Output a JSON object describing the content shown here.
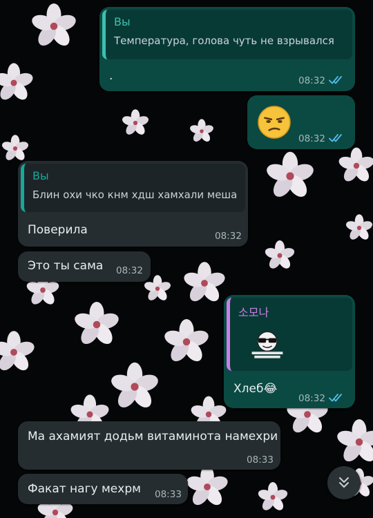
{
  "colors": {
    "outgoing_bubble": "#0b4a43",
    "incoming_bubble": "#262d31",
    "quote_name_self": "#3fbfb0",
    "quote_name_contact": "#c980e6",
    "read_ticks": "#53bdeb"
  },
  "messages": [
    {
      "id": "m1",
      "direction": "outgoing",
      "quote": {
        "author": "Вы",
        "text": "Температура, голова чуть не взрывался"
      },
      "text": ".",
      "time": "08:32",
      "status": "read"
    },
    {
      "id": "m2",
      "direction": "outgoing",
      "emoji": "unamused-face",
      "time": "08:32",
      "status": "read"
    },
    {
      "id": "m3",
      "direction": "incoming",
      "quote": {
        "author": "Вы",
        "text": "Блин охи чко кнм хдш хамхали меша"
      },
      "text": "Поверила",
      "time": "08:32"
    },
    {
      "id": "m4",
      "direction": "incoming",
      "text": "Это ты сама",
      "time": "08:32"
    },
    {
      "id": "m5",
      "direction": "outgoing",
      "quote": {
        "author": "소모나",
        "sticker": "sunglasses-face-sticker"
      },
      "text": "Хлеб😂",
      "time": "08:32",
      "status": "read"
    },
    {
      "id": "m6",
      "direction": "incoming",
      "text": "Ма ахамият додьм витаминота намехри",
      "time": "08:33"
    },
    {
      "id": "m7",
      "direction": "incoming",
      "text": "Факат нагу мехрм",
      "time": "08:33"
    }
  ],
  "scroll_button": {
    "icon": "double-chevron-down-icon"
  }
}
